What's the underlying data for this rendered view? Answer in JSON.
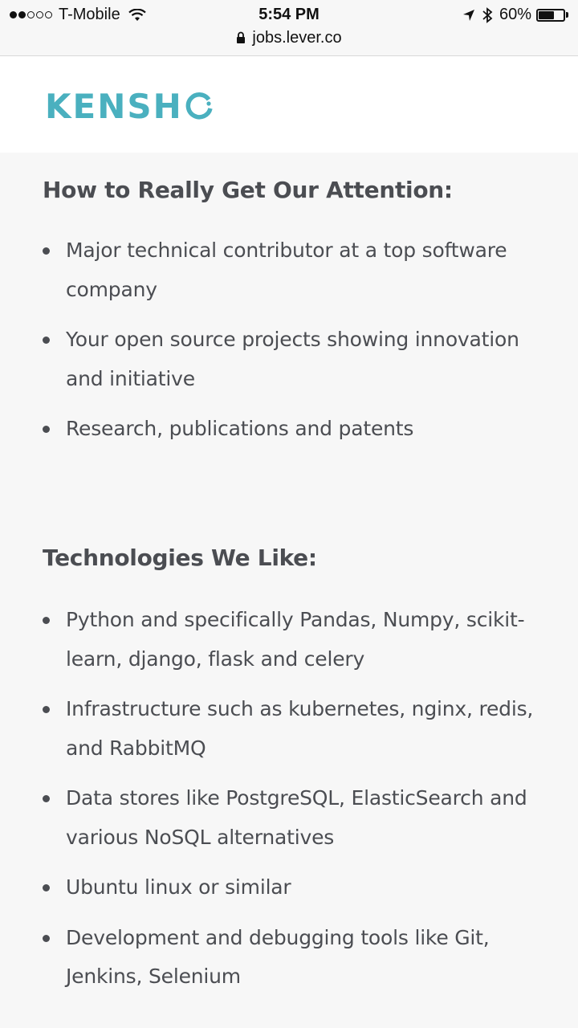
{
  "status_bar": {
    "carrier": "T-Mobile",
    "signal_bars_filled": 2,
    "signal_bars_total": 5,
    "time": "5:54 PM",
    "battery_percent": "60%",
    "battery_level": 0.6,
    "icons": [
      "wifi-icon",
      "location-arrow-icon",
      "bluetooth-icon",
      "battery-icon"
    ]
  },
  "url_bar": {
    "url": "jobs.lever.co",
    "icon": "lock-icon"
  },
  "header": {
    "logo_text": "KENSH",
    "brand_color": "#4ab0bf"
  },
  "sections": [
    {
      "title": "How to Really Get Our Attention:",
      "items": [
        "Major technical contributor at a top software company",
        "Your open source projects showing innovation and initiative",
        "Research, publications and patents"
      ]
    },
    {
      "title": "Technologies We Like:",
      "items": [
        "Python and specifically Pandas, Numpy, scikit-learn, django, flask and celery",
        "Infrastructure such as kubernetes, nginx, redis, and RabbitMQ",
        "Data stores like PostgreSQL, ElasticSearch and various NoSQL alternatives",
        "Ubuntu linux or similar",
        "Development and debugging tools like Git, Jenkins, Selenium"
      ]
    }
  ],
  "colors": {
    "background": "#f7f7f7",
    "text": "#4b4d52",
    "header_bg": "#ffffff"
  }
}
